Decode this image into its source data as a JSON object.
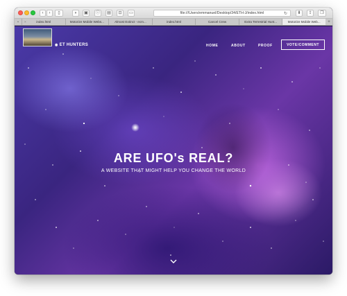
{
  "browser": {
    "address": "file:///Users/emmanuel/Desktop/34/ETH-J/index.html",
    "tabs": [
      {
        "label": "index.html",
        "active": false
      },
      {
        "label": "Motorize Mobile Webs...",
        "active": false
      },
      {
        "label": "Almost Extinct - ecm...",
        "active": false
      },
      {
        "label": "index.html",
        "active": false
      },
      {
        "label": "Cancel Crew",
        "active": false
      },
      {
        "label": "Extra Terrestrial Hunt...",
        "active": false
      },
      {
        "label": "Motorize Mobile Web...",
        "active": true
      }
    ]
  },
  "nav": {
    "brand": "ET HUNTERS",
    "home": "HOME",
    "about": "ABOUT",
    "proof": "PROOF",
    "vote": "VOTE/COMMENT"
  },
  "hero": {
    "title": "ARE UFO's REAL?",
    "subtitle": "A WEBSITE THAT MIGHT HELP YOU CHANGE THE WORLD"
  },
  "icons": {
    "back": "chevron-left-icon",
    "forward": "chevron-right-icon",
    "sidebar": "sidebar-icon",
    "scroll": "chevron-down-icon"
  },
  "colors": {
    "accent": "#ffffff",
    "background": "#3a2580"
  }
}
